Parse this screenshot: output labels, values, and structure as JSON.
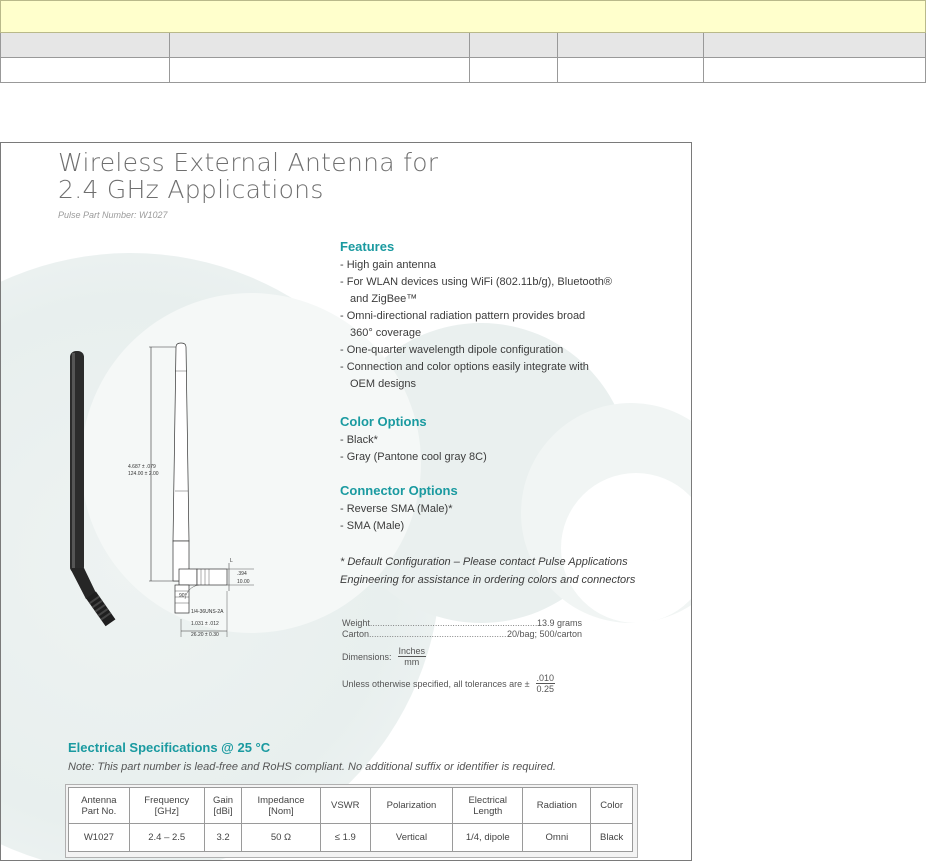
{
  "sheet": {
    "title_line1": "Wireless External Antenna for",
    "title_line2": "2.4 GHz Applications",
    "part_number_label": "Pulse Part Number: W1027"
  },
  "features": {
    "heading": "Features",
    "items": [
      "- High gain antenna",
      "- For WLAN devices using WiFi (802.11b/g), Bluetooth®",
      "   and ZigBee™",
      "- Omni-directional radiation pattern provides broad",
      "   360° coverage",
      "- One-quarter wavelength dipole configuration",
      "- Connection and color options easily integrate with",
      "   OEM designs"
    ]
  },
  "color_options": {
    "heading": "Color Options",
    "items": [
      "- Black*",
      "- Gray (Pantone cool gray 8C)"
    ]
  },
  "connector_options": {
    "heading": "Connector Options",
    "items": [
      "- Reverse SMA (Male)*",
      "- SMA (Male)"
    ]
  },
  "default_note": {
    "line1": "* Default Configuration – Please contact Pulse Applications",
    "line2": "Engineering for assistance in ordering colors and connectors"
  },
  "physical": {
    "weight_label": "Weight",
    "weight_value": "13.9 grams",
    "carton_label": "Carton",
    "carton_value": "20/bag; 500/carton",
    "dimensions_label": "Dimensions:",
    "dimensions_num": "Inches",
    "dimensions_den": "mm",
    "tolerance_label": "Unless otherwise specified, all tolerances are ±",
    "tolerance_num": ".010",
    "tolerance_den": "0.25"
  },
  "drawing": {
    "length_in": "4.687 ± .079",
    "length_mm": "124.00 ± 2.00",
    "width_in": ".394",
    "width_mm": "10.00",
    "base_in": "1.031 ± .012",
    "base_mm": "26.20 ± 0.30",
    "thread": "1/4-36UNS-2A",
    "angle": "90°",
    "label_L": "L"
  },
  "electrical": {
    "title": "Electrical Specifications @ 25 °C",
    "note": "Note: This part number is lead-free and RoHS compliant. No additional suffix or identifier is required.",
    "headers": [
      [
        "Antenna",
        "Part No."
      ],
      [
        "Frequency",
        "[GHz]"
      ],
      [
        "Gain",
        "[dBi]"
      ],
      [
        "Impedance",
        "[Nom]"
      ],
      [
        "VSWR",
        ""
      ],
      [
        "Polarization",
        ""
      ],
      [
        "Electrical",
        "Length"
      ],
      [
        "Radiation",
        ""
      ],
      [
        "Color",
        ""
      ]
    ],
    "row": [
      "W1027",
      "2.4 – 2.5",
      "3.2",
      "50 Ω",
      "≤ 1.9",
      "Vertical",
      "1/4, dipole",
      "Omni",
      "Black"
    ]
  },
  "colors": {
    "accent_teal": "#1a9aa0",
    "banner_yellow": "#ffffcc",
    "header_gray": "#e6e6e6"
  }
}
